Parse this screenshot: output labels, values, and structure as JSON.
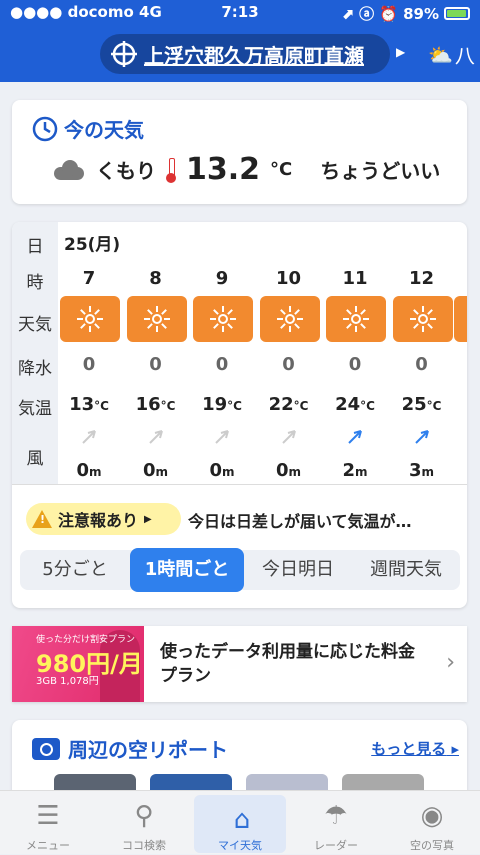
{
  "status": {
    "carrier": "docomo",
    "network": "4G",
    "time": "7:13",
    "icons": "⬈ ⓐ ⏰",
    "battery": "89%",
    "battery_level": 0.89
  },
  "location": {
    "name": "上浮穴郡久万高原町直瀬",
    "next": "八"
  },
  "current": {
    "title": "今の天気",
    "condition": "くもり",
    "temp": "13.2",
    "unit": "°C",
    "feel": "ちょうどいい"
  },
  "hourly": {
    "labels": {
      "day": "日",
      "hour": "時",
      "weather": "天気",
      "precip": "降水",
      "temp": "気温",
      "wind": "風"
    },
    "date": "25(月)",
    "hours": [
      {
        "hour": "7",
        "precip": "0",
        "temp": "13",
        "wind": "0",
        "dir_color": "#ccc"
      },
      {
        "hour": "8",
        "precip": "0",
        "temp": "16",
        "wind": "0",
        "dir_color": "#ccc"
      },
      {
        "hour": "9",
        "precip": "0",
        "temp": "19",
        "wind": "0",
        "dir_color": "#ccc"
      },
      {
        "hour": "10",
        "precip": "0",
        "temp": "22",
        "wind": "0",
        "dir_color": "#ccc"
      },
      {
        "hour": "11",
        "precip": "0",
        "temp": "24",
        "wind": "2",
        "dir_color": "#2f80ed"
      },
      {
        "hour": "12",
        "precip": "0",
        "temp": "25",
        "wind": "3",
        "dir_color": "#2f80ed"
      }
    ],
    "temp_unit": "°C",
    "wind_unit": "m"
  },
  "alert": {
    "badge": "注意報あり",
    "text": "今日は日差しが届いて気温が…"
  },
  "tabs": [
    "5分ごと",
    "1時間ごと",
    "今日明日",
    "週間天気"
  ],
  "ad": {
    "line1": "使った分だけ割安プラン",
    "price": "980円/月",
    "sub": "3GB 1,078円",
    "copy": "使ったデータ利用量に応じた料金プラン"
  },
  "sky": {
    "title": "周辺の空リポート",
    "more": "もっと見る"
  },
  "nav": [
    {
      "label": "メニュー",
      "icon": "☰"
    },
    {
      "label": "ココ検索",
      "icon": "⚲"
    },
    {
      "label": "マイ天気",
      "icon": "⌂"
    },
    {
      "label": "レーダー",
      "icon": "☂"
    },
    {
      "label": "空の写真",
      "icon": "◉"
    }
  ]
}
